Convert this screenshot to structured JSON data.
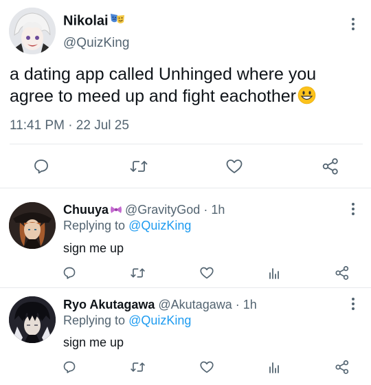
{
  "main_tweet": {
    "display_name": "Nikolai",
    "handle": "@QuizKing",
    "text": "a dating app called Unhinged where you agree to meed up and fight eachother",
    "timestamp": "11:41 PM · 22 Jul 25",
    "emoji_after_name": "theater-masks-emoji",
    "emoji_after_text": "grinning-face-emoji"
  },
  "replies": [
    {
      "display_name": "Chuuya",
      "emoji_after_name": "bow-emoji",
      "handle": "@GravityGod",
      "time": "· 1h",
      "replying_prefix": "Replying to",
      "replying_to": "@QuizKing",
      "text": "sign me up"
    },
    {
      "display_name": "Ryo Akutagawa",
      "handle": "@Akutagawa",
      "time": "· 1h",
      "replying_prefix": "Replying to",
      "replying_to": "@QuizKing",
      "text": "sign me up"
    }
  ],
  "icons": {
    "reply": "reply-icon",
    "retweet": "retweet-icon",
    "like": "like-icon",
    "views": "views-icon",
    "share": "share-icon",
    "more": "more-icon"
  },
  "colors": {
    "text": "#0f1419",
    "secondary": "#536471",
    "link": "#1d9bf0",
    "divider": "#e6e9ec"
  }
}
